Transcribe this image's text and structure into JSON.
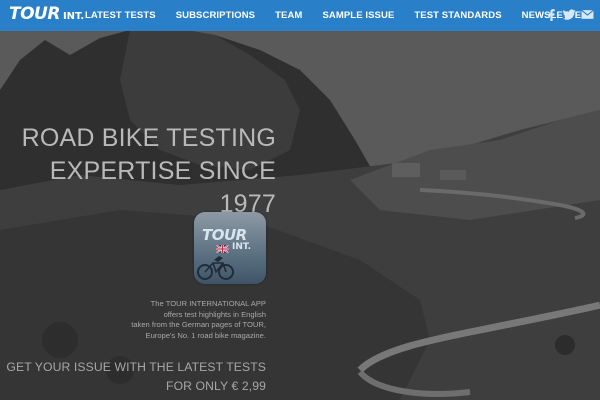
{
  "nav": {
    "logo_main": "TOUR",
    "logo_sub": "INT.",
    "items": [
      {
        "label": "LATEST TESTS"
      },
      {
        "label": "SUBSCRIPTIONS"
      },
      {
        "label": "TEAM"
      },
      {
        "label": "SAMPLE ISSUE"
      },
      {
        "label": "TEST STANDARDS"
      },
      {
        "label": "NEWSLETTER"
      }
    ],
    "social_icons": [
      "facebook-icon",
      "twitter-icon",
      "email-icon"
    ]
  },
  "hero": {
    "headline_line1": "ROAD BIKE TESTING",
    "headline_line2": "EXPERTISE SINCE 1977",
    "app_icon": {
      "logo_main": "TOUR",
      "logo_sub": "INT."
    },
    "desc_line1": "The TOUR INTERNATIONAL APP",
    "desc_line2": "offers test highlights in English",
    "desc_line3": "taken from the German pages of TOUR,",
    "desc_line4": "Europe's No. 1 road bike magazine.",
    "cta_line1": "GET YOUR ISSUE WITH THE LATEST TESTS",
    "cta_line2": "FOR ONLY € 2,99"
  },
  "colors": {
    "nav_bg": "#2a7fc9",
    "overlay": "#3a3a3a"
  }
}
